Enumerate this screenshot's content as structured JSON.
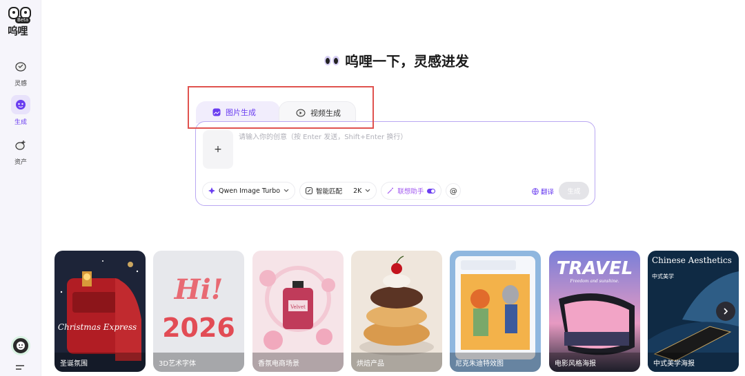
{
  "app": {
    "brand": "呜哩",
    "beta_badge": "Beta"
  },
  "sidebar": {
    "items": [
      {
        "label": "灵感",
        "icon": "inspiration-icon",
        "active": false
      },
      {
        "label": "生成",
        "icon": "generate-icon",
        "active": true
      },
      {
        "label": "资产",
        "icon": "assets-icon",
        "active": false
      }
    ]
  },
  "heading": {
    "title": "呜哩一下，灵感进发"
  },
  "tabs": [
    {
      "label": "图片生成",
      "icon": "image-icon",
      "active": true
    },
    {
      "label": "视频生成",
      "icon": "video-icon",
      "active": false
    }
  ],
  "prompt": {
    "placeholder": "请输入你的创意（按 Enter 发送，Shift+Enter 换行）",
    "value": "",
    "add_label": "+"
  },
  "toolbar": {
    "model": "Qwen Image Turbo",
    "ratio": "智能匹配",
    "resolution": "2K",
    "assistant": "联想助手",
    "assistant_on": true,
    "mention": "@",
    "translate": "翻译",
    "generate": "生成"
  },
  "cards": [
    {
      "label": "圣诞氛围"
    },
    {
      "label": "3D艺术字体"
    },
    {
      "label": "香氛电商场景"
    },
    {
      "label": "烘焙产品"
    },
    {
      "label": "尼克朱迪特效图"
    },
    {
      "label": "电影风格海报"
    },
    {
      "label": "中式美学海报"
    }
  ],
  "card_texts": {
    "christmas": "Christmas Express",
    "hi": "Hi!",
    "year": "2026",
    "perfume": "Velvet",
    "travel": "TRAVEL",
    "travel_sub": "Freedom and sunshine.",
    "chinese_title": "Chinese Aesthetics",
    "chinese_sub": "中式美学"
  },
  "colors": {
    "accent": "#6a3df0",
    "prompt_border": "#b9a7f2",
    "highlight": "#e0524e"
  }
}
